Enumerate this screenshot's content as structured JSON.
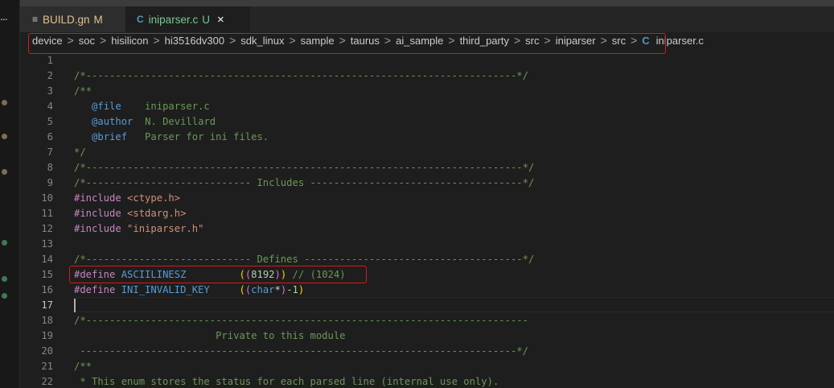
{
  "left_strip": {
    "more_label": "..."
  },
  "tabs": [
    {
      "icon": "≡",
      "label": "BUILD.gn",
      "status": "M"
    },
    {
      "icon": "C",
      "label": "iniparser.c",
      "status": "U",
      "close": "×"
    }
  ],
  "breadcrumb": {
    "items": [
      "device",
      "soc",
      "hisilicon",
      "hi3516dv300",
      "sdk_linux",
      "sample",
      "taurus",
      "ai_sample",
      "third_party",
      "src",
      "iniparser",
      "src"
    ],
    "file_icon": "C",
    "file": "iniparser.c",
    "separator": ">"
  },
  "lines": [
    {
      "n": "1",
      "text": ""
    },
    {
      "n": "2",
      "text": "/*-------------------------------------------------------------------------*/"
    },
    {
      "n": "3",
      "text": "/**"
    },
    {
      "n": "4",
      "pre": "   ",
      "tag": "@file",
      "rest": "    iniparser.c"
    },
    {
      "n": "5",
      "pre": "   ",
      "tag": "@author",
      "rest": "  N. Devillard"
    },
    {
      "n": "6",
      "pre": "   ",
      "tag": "@brief",
      "rest": "   Parser for ini files."
    },
    {
      "n": "7",
      "text": "*/"
    },
    {
      "n": "8",
      "text": "/*--------------------------------------------------------------------------*/"
    },
    {
      "n": "9",
      "text": "/*---------------------------- Includes ------------------------------------*/"
    },
    {
      "n": "10",
      "kw": "#include",
      "rest": " <ctype.h>"
    },
    {
      "n": "11",
      "kw": "#include",
      "rest": " <stdarg.h>"
    },
    {
      "n": "12",
      "kw": "#include",
      "rest": " \"iniparser.h\""
    },
    {
      "n": "13",
      "text": ""
    },
    {
      "n": "14",
      "text": "/*---------------------------- Defines -------------------------------------*/"
    },
    {
      "n": "15",
      "kw": "#define",
      "name": " ASCIILINESZ",
      "pad": "         ",
      "o1": "(",
      "o2": "(",
      "val": "8192",
      "c2": ")",
      "c1": ")",
      "cmt": " // (1024)"
    },
    {
      "n": "16",
      "kw": "#define",
      "name": " INI_INVALID_KEY",
      "pad": "     ",
      "o1": "(",
      "o2": "(",
      "ty": "char",
      "star": "*",
      "c2": ")",
      "tail": "-1",
      "c1": ")"
    },
    {
      "n": "17",
      "text": ""
    },
    {
      "n": "18",
      "text": "/*---------------------------------------------------------------------------"
    },
    {
      "n": "19",
      "text": "                        Private to this module"
    },
    {
      "n": "20",
      "text": " --------------------------------------------------------------------------*/"
    },
    {
      "n": "21",
      "text": "/**"
    },
    {
      "n": "22",
      "text": " * This enum stores the status for each parsed line (internal use only)."
    }
  ],
  "colors": {
    "comment": "#6a9955",
    "keyword": "#c586c0",
    "string": "#ce9178",
    "macro": "#569cd6",
    "number": "#b5cea8",
    "modified": "#e2c08d",
    "untracked": "#73c991",
    "highlight_box": "#d71a1a"
  }
}
